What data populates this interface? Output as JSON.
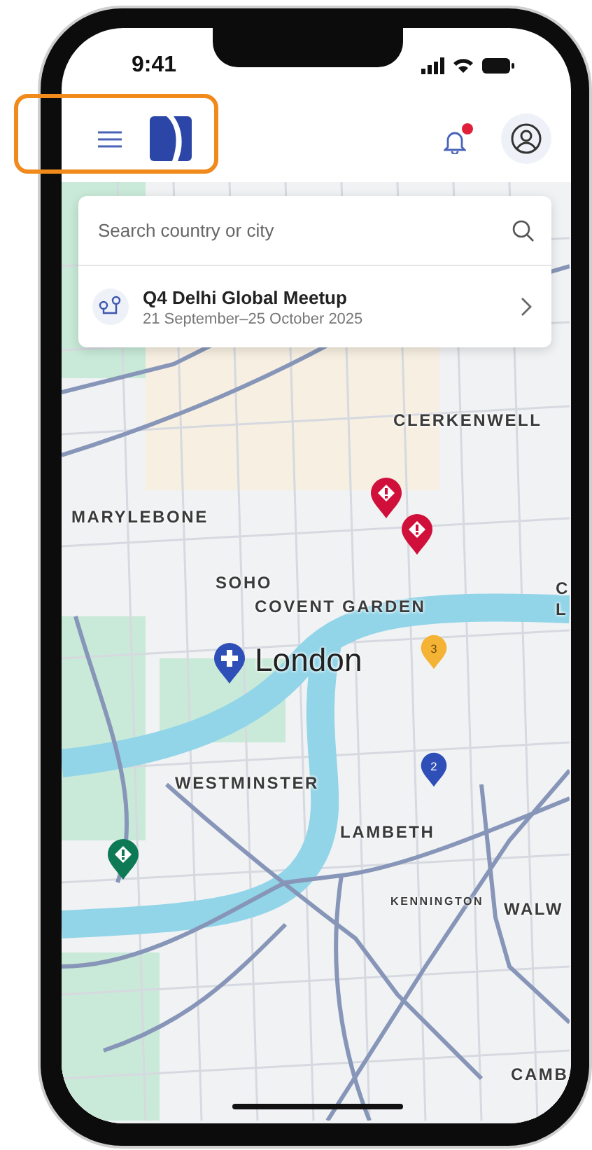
{
  "status_bar": {
    "time": "9:41"
  },
  "header": {
    "notifications": {
      "unread": true
    }
  },
  "search": {
    "placeholder": "Search country or city"
  },
  "event": {
    "title": "Q4 Delhi Global Meetup",
    "dates": "21 September–25 October 2025"
  },
  "map": {
    "labels": [
      {
        "text": "CLERKENWELL",
        "kind": "district"
      },
      {
        "text": "MARYLEBONE",
        "kind": "district"
      },
      {
        "text": "SOHO",
        "kind": "district"
      },
      {
        "text": "COVENT GARDEN",
        "kind": "district"
      },
      {
        "text": "C",
        "kind": "district"
      },
      {
        "text": "L",
        "kind": "district"
      },
      {
        "text": "London",
        "kind": "city"
      },
      {
        "text": "WESTMINSTER",
        "kind": "district"
      },
      {
        "text": "LAMBETH",
        "kind": "district"
      },
      {
        "text": "KENNINGTON",
        "kind": "small"
      },
      {
        "text": "WALW",
        "kind": "district"
      },
      {
        "text": "CAMB",
        "kind": "district"
      }
    ],
    "pins": [
      {
        "kind": "alert",
        "color": "#d0103a"
      },
      {
        "kind": "alert",
        "color": "#d0103a"
      },
      {
        "kind": "hospital",
        "color": "#2f4fb8"
      },
      {
        "kind": "cluster",
        "color": "#f5b335",
        "count": "3"
      },
      {
        "kind": "cluster",
        "color": "#2f4fb8",
        "count": "2"
      },
      {
        "kind": "alert",
        "color": "#0e7a55"
      }
    ]
  }
}
